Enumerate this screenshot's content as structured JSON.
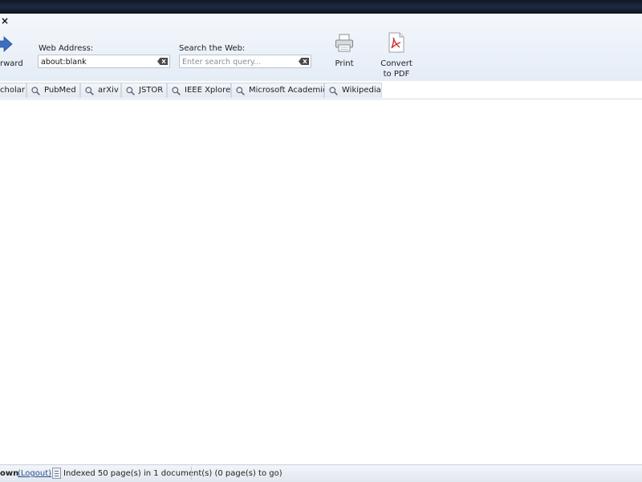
{
  "window": {
    "close_glyph": "×"
  },
  "toolbar": {
    "forward_label": "rward",
    "web_address_label": "Web Address:",
    "web_address_value": "about:blank",
    "search_label": "Search the Web:",
    "search_placeholder": "Enter search query...",
    "print_label": "Print",
    "convert_label_line1": "Convert",
    "convert_label_line2": "to PDF"
  },
  "search_tabs": [
    {
      "label": "cholar",
      "icon": "magnifier-icon"
    },
    {
      "label": "PubMed",
      "icon": "magnifier-icon"
    },
    {
      "label": "arXiv",
      "icon": "magnifier-icon"
    },
    {
      "label": "JSTOR",
      "icon": "magnifier-icon"
    },
    {
      "label": "IEEE Xplore",
      "icon": "magnifier-icon"
    },
    {
      "label": "Microsoft Academic",
      "icon": "magnifier-icon"
    },
    {
      "label": "Wikipedia",
      "icon": "magnifier-icon"
    }
  ],
  "status": {
    "user": "own",
    "logout": "(Logout)",
    "index_text": "Indexed 50 page(s) in 1 document(s) (0 page(s) to go)"
  },
  "colors": {
    "forward_arrow": "#3b6fc0",
    "pdf_red": "#c8302c",
    "logout_link": "#2a4d8f"
  }
}
